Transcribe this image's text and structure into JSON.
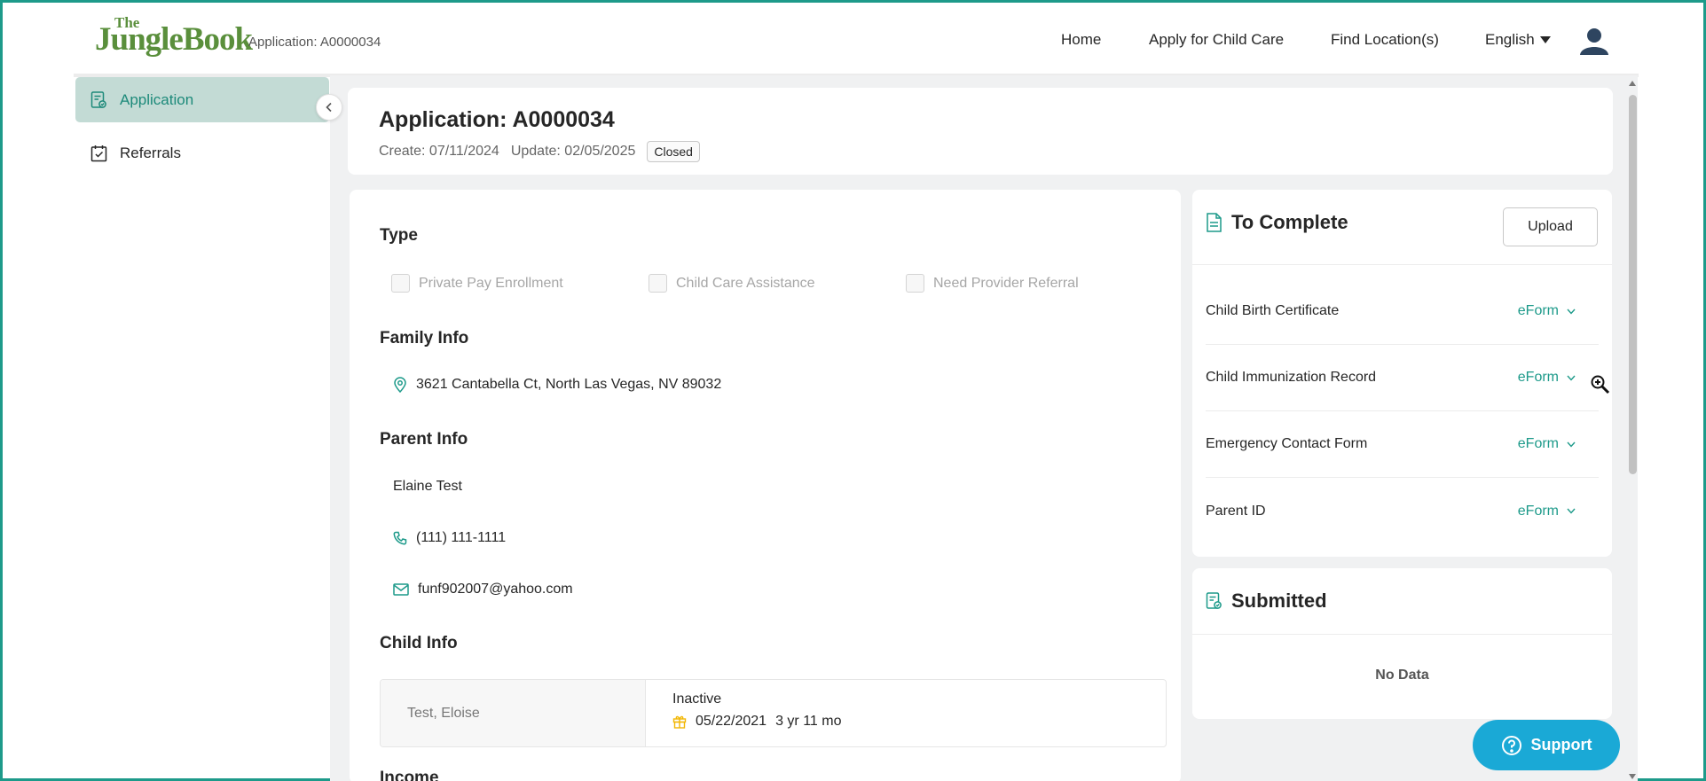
{
  "header": {
    "logo_small": "The",
    "logo_big": "JungleBook",
    "application_id": "Application: A0000034",
    "nav": [
      "Home",
      "Apply for Child Care",
      "Find Location(s)"
    ],
    "language": "English"
  },
  "sidebar": {
    "items": [
      {
        "label": "Application",
        "icon": "application-icon",
        "active": true
      },
      {
        "label": "Referrals",
        "icon": "calendar-check-icon",
        "active": false
      }
    ]
  },
  "application": {
    "title": "Application: A0000034",
    "create": "Create: 07/11/2024",
    "update": "Update: 02/05/2025",
    "status": "Closed"
  },
  "details": {
    "type_title": "Type",
    "types": [
      "Private Pay Enrollment",
      "Child Care Assistance",
      "Need Provider Referral"
    ],
    "family_title": "Family Info",
    "address": "3621 Cantabella Ct, North Las Vegas, NV 89032",
    "parent_title": "Parent Info",
    "parent_name": "Elaine Test",
    "phone": "(111) 111-1111",
    "email": "funf902007@yahoo.com",
    "child_title": "Child Info",
    "child": {
      "name": "Test, Eloise",
      "status": "Inactive",
      "dob": "05/22/2021",
      "age": "3 yr 11 mo"
    },
    "income_title": "Income"
  },
  "to_complete": {
    "title": "To Complete",
    "upload_label": "Upload",
    "documents": [
      {
        "name": "Child Birth Certificate",
        "action": "eForm"
      },
      {
        "name": "Child Immunization Record",
        "action": "eForm"
      },
      {
        "name": "Emergency Contact Form",
        "action": "eForm"
      },
      {
        "name": "Parent ID",
        "action": "eForm"
      }
    ]
  },
  "submitted": {
    "title": "Submitted",
    "empty_text": "No Data"
  },
  "support": {
    "label": "Support"
  },
  "colors": {
    "accent": "#1d9a8a",
    "support": "#1aa9d6",
    "sidebar_active": "#c3dbd5",
    "logo": "#5a8f3c"
  }
}
